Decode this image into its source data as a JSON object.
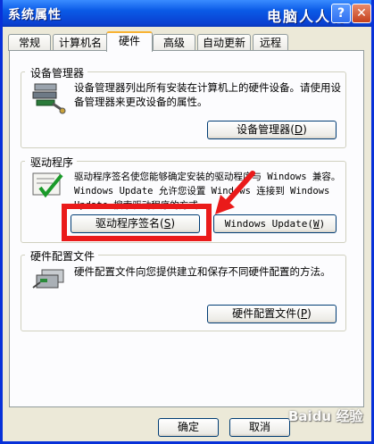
{
  "window": {
    "title": "系统属性",
    "brand": "电脑人人有",
    "help_label": "?",
    "close_label": "✕"
  },
  "tabs": [
    {
      "label": "常规"
    },
    {
      "label": "计算机名"
    },
    {
      "label": "硬件"
    },
    {
      "label": "高级"
    },
    {
      "label": "自动更新"
    },
    {
      "label": "远程"
    }
  ],
  "device_manager": {
    "group_label": "设备管理器",
    "description": "设备管理器列出所有安装在计算机上的硬件设备。请使用设备管理器来更改设备的属性。",
    "button": "设备管理器",
    "button_key": "D"
  },
  "drivers": {
    "group_label": "驱动程序",
    "description": "驱动程序签名使您能够确定安装的驱动程序与 Windows 兼容。Windows Update 允许您设置 Windows 连接到 Windows Update 搜索驱动程序的方式。",
    "signing_button": "驱动程序签名",
    "signing_key": "S",
    "update_button": "Windows Update",
    "update_key": "W"
  },
  "hardware_profiles": {
    "group_label": "硬件配置文件",
    "description": "硬件配置文件向您提供建立和保存不同硬件配置的方法。",
    "button": "硬件配置文件",
    "button_key": "P"
  },
  "footer": {
    "ok": "确定",
    "cancel": "取消",
    "watermark": "Baidu 经验"
  },
  "colors": {
    "titlebar": "#0a5ae6",
    "highlight": "#ea1a1a",
    "tab_accent": "#f8b334"
  }
}
